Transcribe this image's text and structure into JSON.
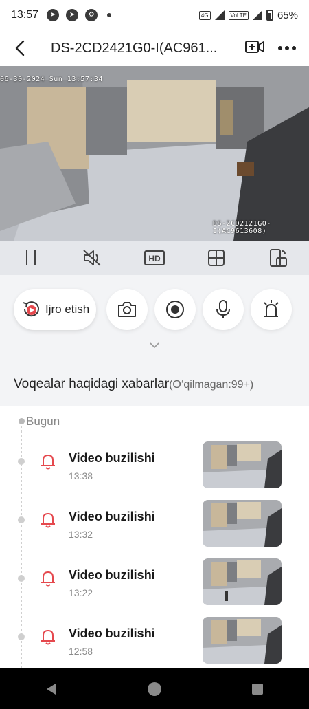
{
  "status_bar": {
    "time": "13:57",
    "network": "4G",
    "volte": "VoLTE",
    "battery": "65%"
  },
  "header": {
    "title": "DS-2CD2421G0-I(AC961..."
  },
  "video": {
    "osd_datetime": "06-30-2024 Sun 13:57:34",
    "camera_label": "DS-2CD2121G0-I(AC9613608)"
  },
  "controls": {
    "hd_label": "HD"
  },
  "actions": {
    "playback_label": "Ijro etish"
  },
  "events": {
    "title": "Voqealar haqidagi xabarlar",
    "unread": "(O‘qilmagan:99+)",
    "day_label": "Bugun",
    "items": [
      {
        "name": "Video buzilishi",
        "time": "13:38"
      },
      {
        "name": "Video buzilishi",
        "time": "13:32"
      },
      {
        "name": "Video buzilishi",
        "time": "13:22"
      },
      {
        "name": "Video buzilishi",
        "time": "12:58"
      }
    ]
  },
  "colors": {
    "accent_red": "#e5484d",
    "control_bar": "#e5e7eb",
    "background": "#f3f4f6"
  }
}
